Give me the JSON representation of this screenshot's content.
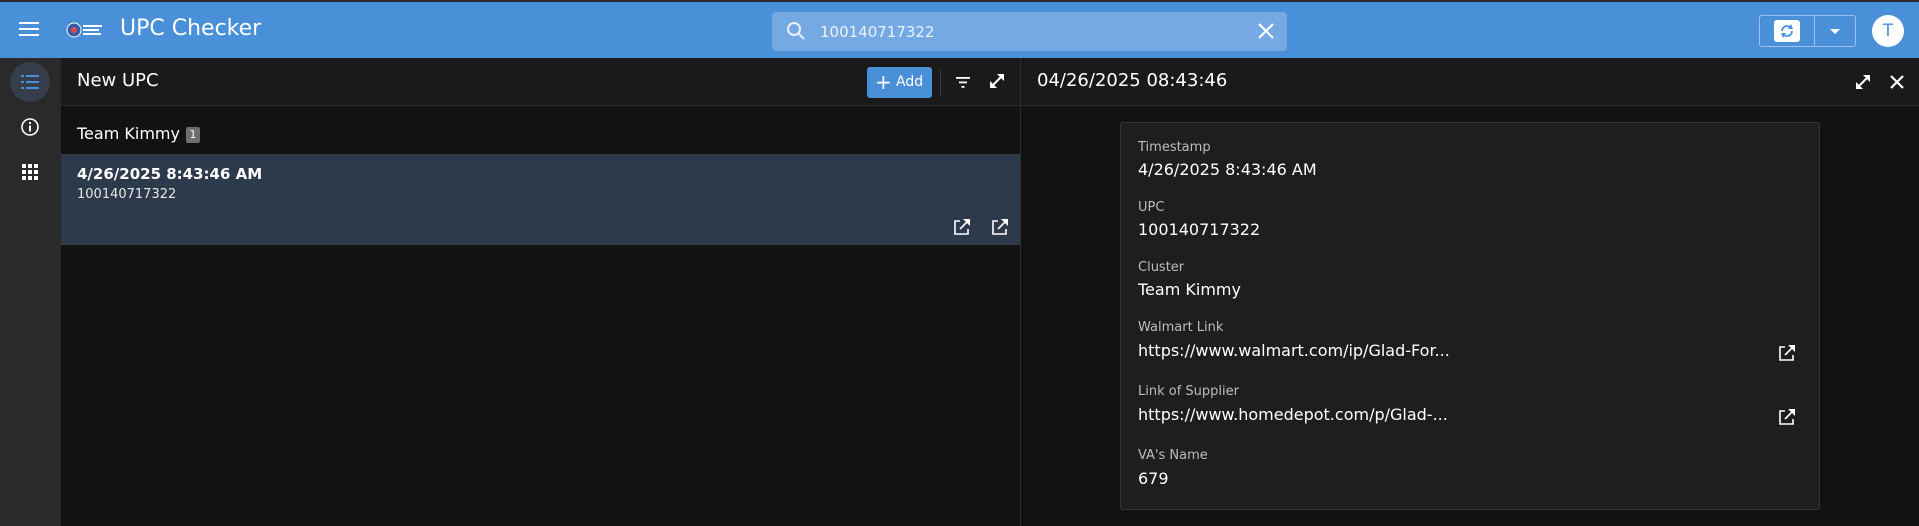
{
  "app": {
    "title": "UPC Checker",
    "logo_icon": "company-logo-icon",
    "avatar_initial": "T"
  },
  "search": {
    "value": "100140717322",
    "placeholder": ""
  },
  "sidebar": {
    "items": [
      {
        "icon": "list-icon",
        "active": true
      },
      {
        "icon": "info-icon",
        "active": false
      },
      {
        "icon": "apps-grid-icon",
        "active": false
      }
    ]
  },
  "list_panel": {
    "title": "New UPC",
    "add_label": "Add",
    "group": {
      "label": "Team Kimmy",
      "count": "1"
    },
    "rows": [
      {
        "title": "4/26/2025 8:43:46 AM",
        "subtitle": "100140717322"
      }
    ]
  },
  "detail_panel": {
    "title": "04/26/2025 08:43:46",
    "fields": [
      {
        "label": "Timestamp",
        "value": "4/26/2025 8:43:46 AM"
      },
      {
        "label": "UPC",
        "value": "100140717322"
      },
      {
        "label": "Cluster",
        "value": "Team Kimmy"
      },
      {
        "label": "Walmart Link",
        "value": "https://www.walmart.com/ip/Glad-For..."
      },
      {
        "label": "Link of Supplier",
        "value": "https://www.homedepot.com/p/Glad-..."
      },
      {
        "label": "VA's Name",
        "value": "679"
      }
    ]
  },
  "colors": {
    "primary": "#4a90d9",
    "background": "#121212",
    "selected_row": "#2c3a4b"
  }
}
